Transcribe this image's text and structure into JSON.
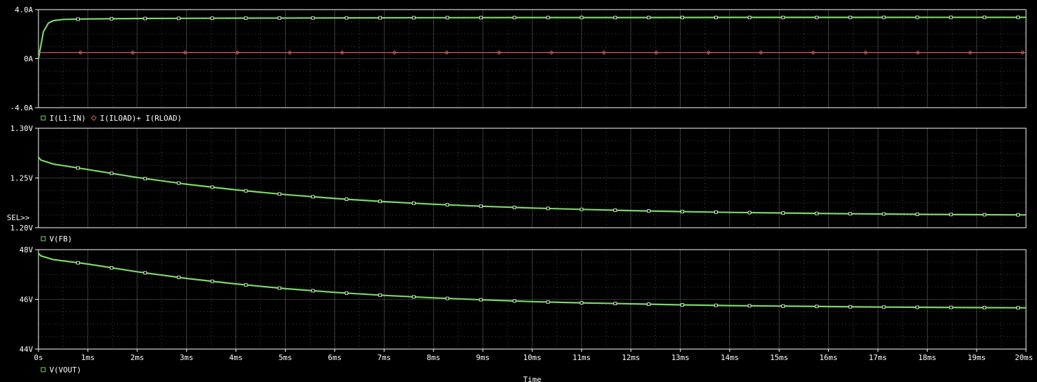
{
  "colors": {
    "background": "#000000",
    "grid": "#ffffff",
    "green_trace": "#7dd86a",
    "red_trace": "#d0605a",
    "text": "#ffffff"
  },
  "x_axis": {
    "label": "Time",
    "ticks": [
      "0s",
      "1ms",
      "2ms",
      "3ms",
      "4ms",
      "5ms",
      "6ms",
      "7ms",
      "8ms",
      "9ms",
      "10ms",
      "11ms",
      "12ms",
      "13ms",
      "14ms",
      "15ms",
      "16ms",
      "17ms",
      "18ms",
      "19ms",
      "20ms"
    ]
  },
  "selector_marker": "SEL>>",
  "chart_data": [
    {
      "type": "line",
      "ylim": [
        -4.0,
        4.0
      ],
      "y_ticks": [
        "4.0A",
        "0A",
        "-4.0A"
      ],
      "y_tick_values": [
        4.0,
        0,
        -4.0
      ],
      "legend": [
        {
          "text": "I(L1:IN)",
          "color": "#7dd86a",
          "marker": "square"
        },
        {
          "text": "I(ILOAD)+ I(RLOAD)",
          "color": "#d0605a",
          "marker": "diamond"
        }
      ],
      "series": [
        {
          "name": "I(L1:IN)",
          "color": "#7dd86a",
          "x_ms": [
            0,
            0.1,
            0.2,
            0.3,
            0.5,
            0.8,
            1,
            2,
            4,
            6,
            8,
            10,
            12,
            14,
            16,
            18,
            20
          ],
          "y": [
            0,
            2.2,
            2.9,
            3.1,
            3.2,
            3.22,
            3.24,
            3.27,
            3.3,
            3.32,
            3.34,
            3.35,
            3.35,
            3.36,
            3.36,
            3.37,
            3.37
          ]
        },
        {
          "name": "I(ILOAD)+ I(RLOAD)",
          "color": "#d0605a",
          "x_ms": [
            0,
            20
          ],
          "y": [
            0.5,
            0.5
          ]
        }
      ]
    },
    {
      "type": "line",
      "ylim": [
        1.2,
        1.3
      ],
      "y_ticks": [
        "1.30V",
        "1.25V",
        "1.20V"
      ],
      "y_tick_values": [
        1.3,
        1.25,
        1.2
      ],
      "legend": [
        {
          "text": "V(FB)",
          "color": "#7dd86a",
          "marker": "square"
        }
      ],
      "series": [
        {
          "name": "V(FB)",
          "color": "#7dd86a",
          "x_ms": [
            0,
            0.05,
            0.3,
            1,
            2,
            3,
            4,
            5,
            6,
            7,
            8,
            9,
            10,
            11,
            12,
            13,
            14,
            15,
            16,
            17,
            18,
            19,
            20
          ],
          "y": [
            1.271,
            1.268,
            1.264,
            1.2585,
            1.2505,
            1.2437,
            1.238,
            1.2333,
            1.2294,
            1.2262,
            1.2236,
            1.2215,
            1.2198,
            1.2184,
            1.2172,
            1.2162,
            1.2154,
            1.2148,
            1.2142,
            1.2138,
            1.2134,
            1.2131,
            1.2129
          ]
        }
      ]
    },
    {
      "type": "line",
      "ylim": [
        44,
        48
      ],
      "y_ticks": [
        "48V",
        "46V",
        "44V"
      ],
      "y_tick_values": [
        48,
        46,
        44
      ],
      "legend": [
        {
          "text": "V(VOUT)",
          "color": "#7dd86a",
          "marker": "square"
        }
      ],
      "series": [
        {
          "name": "V(VOUT)",
          "color": "#7dd86a",
          "x_ms": [
            0,
            0.05,
            0.3,
            1,
            2,
            3,
            4,
            5,
            6,
            7,
            8,
            9,
            10,
            11,
            12,
            13,
            14,
            15,
            16,
            17,
            18,
            19,
            20
          ],
          "y": [
            47.85,
            47.75,
            47.6,
            47.42,
            47.11,
            46.84,
            46.62,
            46.43,
            46.28,
            46.16,
            46.06,
            45.98,
            45.91,
            45.86,
            45.82,
            45.78,
            45.75,
            45.73,
            45.71,
            45.69,
            45.68,
            45.67,
            45.66
          ]
        }
      ]
    }
  ]
}
